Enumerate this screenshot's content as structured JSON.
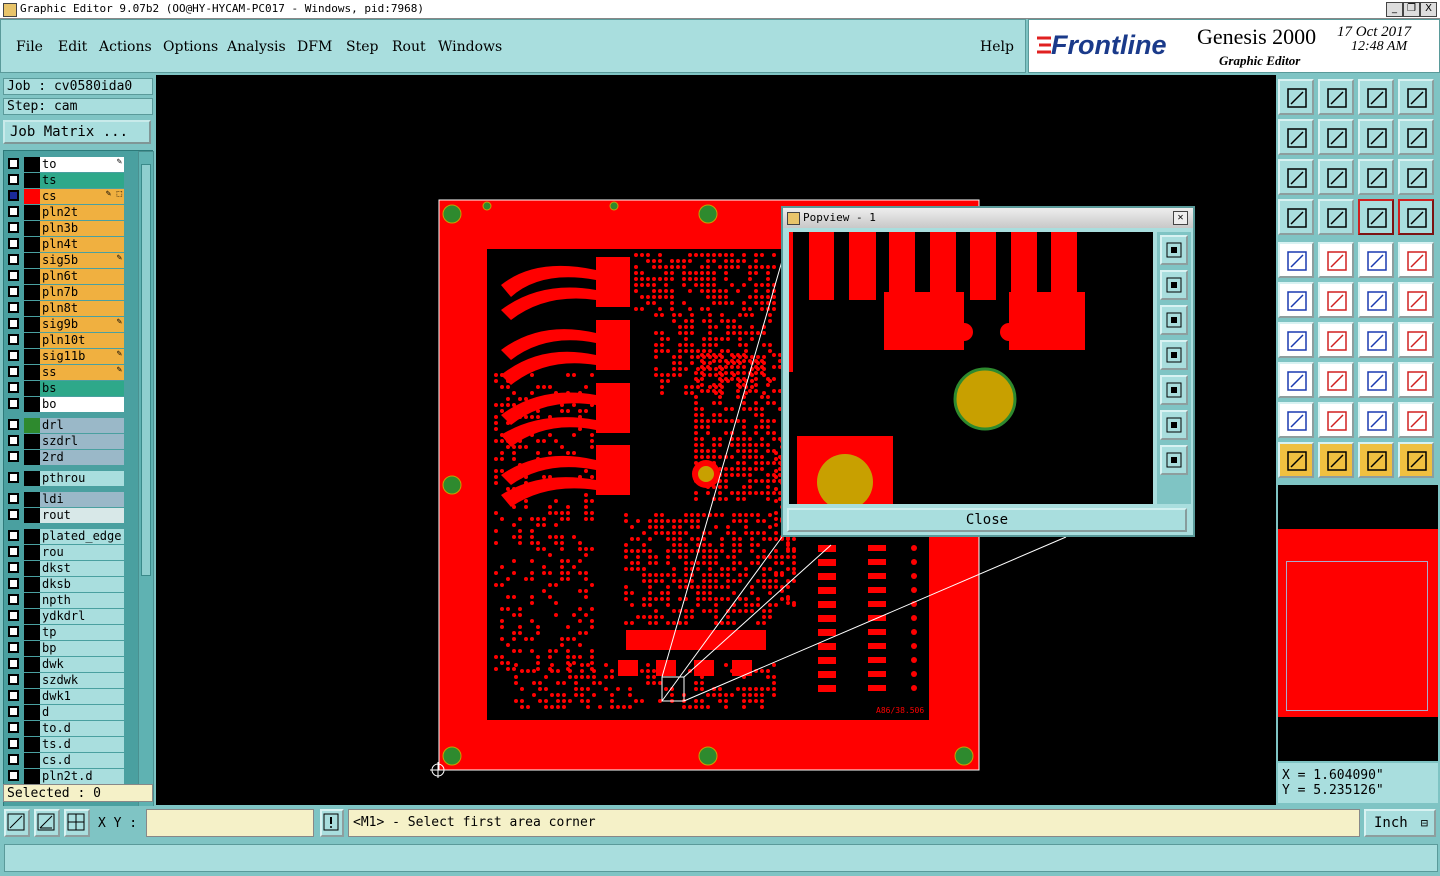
{
  "window": {
    "title": "Graphic Editor 9.07b2 (OO@HY-HYCAM-PC017 - Windows, pid:7968)",
    "min_label": "_",
    "max_label": "❐",
    "close_label": "X"
  },
  "menu": {
    "items": [
      "File",
      "Edit",
      "Actions",
      "Options",
      "Analysis",
      "DFM",
      "Step",
      "Rout",
      "Windows"
    ],
    "help": "Help"
  },
  "logo": {
    "brand": "Frontline",
    "product": "Genesis 2000",
    "subtitle": "Graphic Editor",
    "date": "17 Oct 2017",
    "time": "12:48 AM"
  },
  "job": {
    "job_label": "Job : cv0580ida0",
    "step_label": "Step: cam",
    "matrix_button": "Job Matrix ..."
  },
  "layers": [
    {
      "name": "to",
      "color": "#ffffff",
      "swatch": "#000000",
      "mark": "✎"
    },
    {
      "name": "ts",
      "color": "#2ea88a",
      "swatch": "#000000",
      "mark": ""
    },
    {
      "name": "cs",
      "color": "#f0b040",
      "swatch": "#ff0000",
      "mark": "✎ ⬚",
      "selected": true
    },
    {
      "name": "pln2t",
      "color": "#f0b040",
      "swatch": "#000000",
      "mark": ""
    },
    {
      "name": "pln3b",
      "color": "#f0b040",
      "swatch": "#000000",
      "mark": ""
    },
    {
      "name": "pln4t",
      "color": "#f0b040",
      "swatch": "#000000",
      "mark": ""
    },
    {
      "name": "sig5b",
      "color": "#f0b040",
      "swatch": "#000000",
      "mark": "✎"
    },
    {
      "name": "pln6t",
      "color": "#f0b040",
      "swatch": "#000000",
      "mark": ""
    },
    {
      "name": "pln7b",
      "color": "#f0b040",
      "swatch": "#000000",
      "mark": ""
    },
    {
      "name": "pln8t",
      "color": "#f0b040",
      "swatch": "#000000",
      "mark": ""
    },
    {
      "name": "sig9b",
      "color": "#f0b040",
      "swatch": "#000000",
      "mark": "✎"
    },
    {
      "name": "pln10t",
      "color": "#f0b040",
      "swatch": "#000000",
      "mark": ""
    },
    {
      "name": "sig11b",
      "color": "#f0b040",
      "swatch": "#000000",
      "mark": "✎"
    },
    {
      "name": "ss",
      "color": "#f0b040",
      "swatch": "#000000",
      "mark": "✎"
    },
    {
      "name": "bs",
      "color": "#2ea88a",
      "swatch": "#000000",
      "mark": ""
    },
    {
      "name": "bo",
      "color": "#ffffff",
      "swatch": "#000000",
      "mark": ""
    },
    {
      "name": "drl",
      "color": "#9ab8c8",
      "swatch": "#2e8a2e",
      "mark": ""
    },
    {
      "name": "szdrl",
      "color": "#9ab8c8",
      "swatch": "#000000",
      "mark": ""
    },
    {
      "name": "2rd",
      "color": "#9ab8c8",
      "swatch": "#000000",
      "mark": ""
    },
    {
      "name": "pthrou",
      "color": "#a9dede",
      "swatch": "#000000",
      "mark": ""
    },
    {
      "name": "ldi",
      "color": "#9ab8c8",
      "swatch": "#000000",
      "mark": ""
    },
    {
      "name": "rout",
      "color": "#d8e8e8",
      "swatch": "#000000",
      "mark": ""
    },
    {
      "name": "plated_edge",
      "color": "#a9dede",
      "swatch": "#000000",
      "mark": ""
    },
    {
      "name": "rou",
      "color": "#a9dede",
      "swatch": "#000000",
      "mark": ""
    },
    {
      "name": "dkst",
      "color": "#a9dede",
      "swatch": "#000000",
      "mark": ""
    },
    {
      "name": "dksb",
      "color": "#a9dede",
      "swatch": "#000000",
      "mark": ""
    },
    {
      "name": "npth",
      "color": "#a9dede",
      "swatch": "#000000",
      "mark": ""
    },
    {
      "name": "ydkdrl",
      "color": "#a9dede",
      "swatch": "#000000",
      "mark": ""
    },
    {
      "name": "tp",
      "color": "#a9dede",
      "swatch": "#000000",
      "mark": ""
    },
    {
      "name": "bp",
      "color": "#a9dede",
      "swatch": "#000000",
      "mark": ""
    },
    {
      "name": "dwk",
      "color": "#a9dede",
      "swatch": "#000000",
      "mark": ""
    },
    {
      "name": "szdwk",
      "color": "#a9dede",
      "swatch": "#000000",
      "mark": ""
    },
    {
      "name": "dwk1",
      "color": "#a9dede",
      "swatch": "#000000",
      "mark": ""
    },
    {
      "name": "d",
      "color": "#a9dede",
      "swatch": "#000000",
      "mark": ""
    },
    {
      "name": "to.d",
      "color": "#a9dede",
      "swatch": "#000000",
      "mark": ""
    },
    {
      "name": "ts.d",
      "color": "#a9dede",
      "swatch": "#000000",
      "mark": ""
    },
    {
      "name": "cs.d",
      "color": "#a9dede",
      "swatch": "#000000",
      "mark": ""
    },
    {
      "name": "pln2t.d",
      "color": "#a9dede",
      "swatch": "#000000",
      "mark": ""
    }
  ],
  "selected_count": "Selected : 0",
  "popview": {
    "title": "Popview - 1",
    "close_button": "Close"
  },
  "board": {
    "label": "A86/38.506"
  },
  "coords": {
    "x": "X = 1.604090\"",
    "y": "Y = 5.235126\""
  },
  "bottom": {
    "xy_label": "X Y :",
    "xy_value": "",
    "prompt": "<M1> - Select first area corner",
    "units": "Inch",
    "status": ""
  },
  "colors": {
    "panel": "#7fc4c4",
    "panel_light": "#a9dede",
    "copper": "#ff0000",
    "pad": "#c8a000",
    "hole": "#2e8a2e"
  }
}
